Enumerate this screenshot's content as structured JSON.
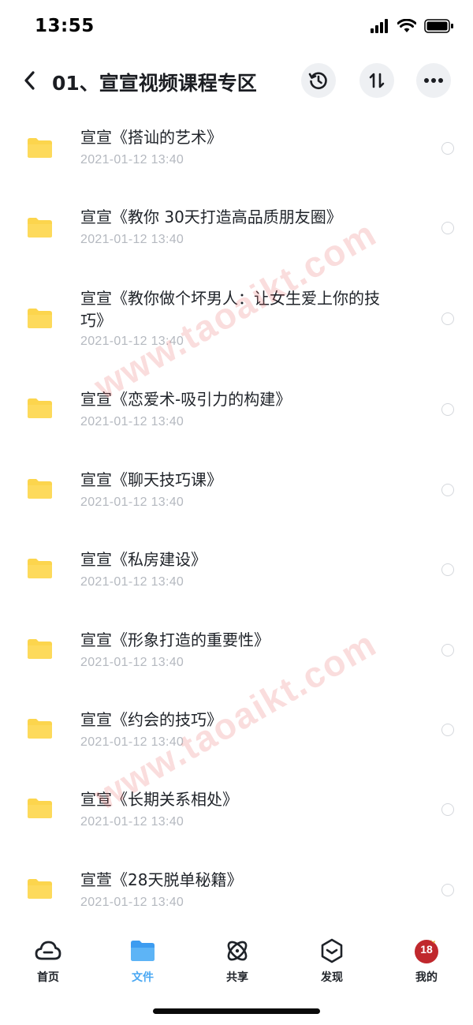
{
  "status_bar": {
    "time": "13:55"
  },
  "header": {
    "title": "01、宣宣视频课程专区"
  },
  "files": [
    {
      "name": "宣宣《搭讪的艺术》",
      "date": "2021-01-12 13:40"
    },
    {
      "name": "宣宣《教你 30天打造高品质朋友圈》",
      "date": "2021-01-12 13:40"
    },
    {
      "name": "宣宣《教你做个坏男人：让女生爱上你的技巧》",
      "date": "2021-01-12 13:40"
    },
    {
      "name": "宣宣《恋爱术-吸引力的构建》",
      "date": "2021-01-12 13:40"
    },
    {
      "name": "宣宣《聊天技巧课》",
      "date": "2021-01-12 13:40"
    },
    {
      "name": "宣宣《私房建设》",
      "date": "2021-01-12 13:40"
    },
    {
      "name": "宣宣《形象打造的重要性》",
      "date": "2021-01-12 13:40"
    },
    {
      "name": "宣宣《约会的技巧》",
      "date": "2021-01-12 13:40"
    },
    {
      "name": "宣宣《长期关系相处》",
      "date": "2021-01-12 13:40"
    },
    {
      "name": "宣萱《28天脱单秘籍》",
      "date": "2021-01-12 13:40"
    }
  ],
  "watermark": {
    "text": "www.taoaikt.com"
  },
  "bottom_nav": [
    {
      "label": "首页",
      "icon": "cloud-icon",
      "active": false
    },
    {
      "label": "文件",
      "icon": "folder-icon",
      "active": true
    },
    {
      "label": "共享",
      "icon": "orbit-icon",
      "active": false
    },
    {
      "label": "发现",
      "icon": "discover-icon",
      "active": false
    },
    {
      "label": "我的",
      "icon": "avatar-icon",
      "active": false,
      "badge": "18"
    }
  ],
  "colors": {
    "folder": "#fcd54d",
    "accent": "#4aa8f3",
    "date_text": "#b5b9c0",
    "watermark": "#e86262"
  }
}
